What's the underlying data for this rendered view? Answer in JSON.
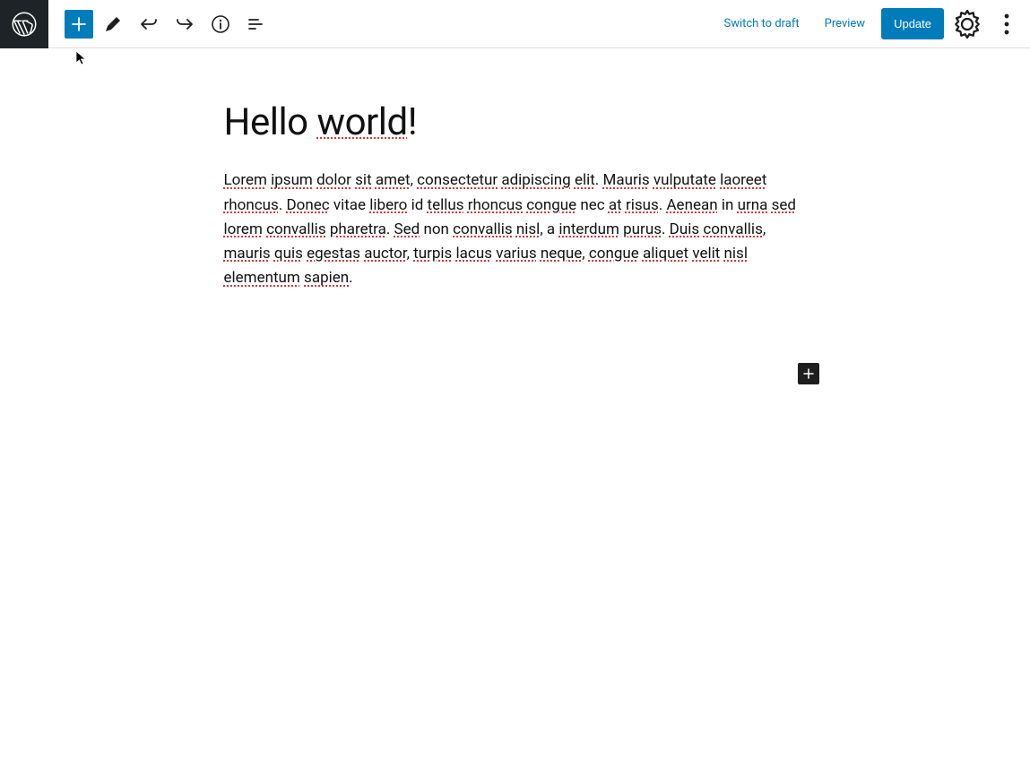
{
  "toolbar": {
    "switch_to_draft": "Switch to draft",
    "preview": "Preview",
    "update": "Update"
  },
  "post": {
    "title_plain": "Hello ",
    "title_misspell": "world",
    "title_tail": "!",
    "body_segments": [
      {
        "t": "Lorem",
        "s": true
      },
      {
        "t": " ",
        "s": false
      },
      {
        "t": "ipsum",
        "s": true
      },
      {
        "t": " ",
        "s": false
      },
      {
        "t": "dolor",
        "s": true
      },
      {
        "t": " ",
        "s": false
      },
      {
        "t": "sit",
        "s": true
      },
      {
        "t": " ",
        "s": false
      },
      {
        "t": "amet",
        "s": true
      },
      {
        "t": ", ",
        "s": false
      },
      {
        "t": "consectetur",
        "s": true
      },
      {
        "t": " ",
        "s": false
      },
      {
        "t": "adipiscing",
        "s": true
      },
      {
        "t": " ",
        "s": false
      },
      {
        "t": "elit",
        "s": true
      },
      {
        "t": ". ",
        "s": false
      },
      {
        "t": "Mauris",
        "s": true
      },
      {
        "t": " ",
        "s": false
      },
      {
        "t": "vulputate",
        "s": true
      },
      {
        "t": " ",
        "s": false
      },
      {
        "t": "laoreet",
        "s": true
      },
      {
        "t": " ",
        "s": false
      },
      {
        "t": "rhoncus",
        "s": true
      },
      {
        "t": ". ",
        "s": false
      },
      {
        "t": "Donec",
        "s": true
      },
      {
        "t": " vitae ",
        "s": false
      },
      {
        "t": "libero",
        "s": true
      },
      {
        "t": " id ",
        "s": false
      },
      {
        "t": "tellus",
        "s": true
      },
      {
        "t": " ",
        "s": false
      },
      {
        "t": "rhoncus",
        "s": true
      },
      {
        "t": " ",
        "s": false
      },
      {
        "t": "congue",
        "s": true
      },
      {
        "t": " nec ",
        "s": false
      },
      {
        "t": "at",
        "s": true
      },
      {
        "t": " ",
        "s": false
      },
      {
        "t": "risus",
        "s": true
      },
      {
        "t": ". ",
        "s": false
      },
      {
        "t": "Aenean",
        "s": true
      },
      {
        "t": " in ",
        "s": false
      },
      {
        "t": "urna",
        "s": true
      },
      {
        "t": " ",
        "s": false
      },
      {
        "t": "sed",
        "s": true
      },
      {
        "t": " ",
        "s": false
      },
      {
        "t": "lorem",
        "s": true
      },
      {
        "t": " ",
        "s": false
      },
      {
        "t": "convallis",
        "s": true
      },
      {
        "t": " ",
        "s": false
      },
      {
        "t": "pharetra",
        "s": true
      },
      {
        "t": ". ",
        "s": false
      },
      {
        "t": "Sed",
        "s": true
      },
      {
        "t": " non ",
        "s": false
      },
      {
        "t": "convallis",
        "s": true
      },
      {
        "t": " ",
        "s": false
      },
      {
        "t": "nisl",
        "s": true
      },
      {
        "t": ", a ",
        "s": false
      },
      {
        "t": "interdum",
        "s": true
      },
      {
        "t": " ",
        "s": false
      },
      {
        "t": "purus",
        "s": true
      },
      {
        "t": ". ",
        "s": false
      },
      {
        "t": "Duis",
        "s": true
      },
      {
        "t": " ",
        "s": false
      },
      {
        "t": "convallis",
        "s": true
      },
      {
        "t": ", ",
        "s": false
      },
      {
        "t": "mauris",
        "s": true
      },
      {
        "t": " ",
        "s": false
      },
      {
        "t": "quis",
        "s": true
      },
      {
        "t": " ",
        "s": false
      },
      {
        "t": "egestas",
        "s": true
      },
      {
        "t": " ",
        "s": false
      },
      {
        "t": "auctor",
        "s": true
      },
      {
        "t": ", ",
        "s": false
      },
      {
        "t": "turpis",
        "s": true
      },
      {
        "t": " ",
        "s": false
      },
      {
        "t": "lacus",
        "s": true
      },
      {
        "t": " ",
        "s": false
      },
      {
        "t": "varius",
        "s": true
      },
      {
        "t": " ",
        "s": false
      },
      {
        "t": "neque",
        "s": true
      },
      {
        "t": ", ",
        "s": false
      },
      {
        "t": "congue",
        "s": true
      },
      {
        "t": " ",
        "s": false
      },
      {
        "t": "aliquet",
        "s": true
      },
      {
        "t": " ",
        "s": false
      },
      {
        "t": "velit",
        "s": true
      },
      {
        "t": " ",
        "s": false
      },
      {
        "t": "nisl",
        "s": true
      },
      {
        "t": " ",
        "s": false
      },
      {
        "t": "elementum",
        "s": true
      },
      {
        "t": " ",
        "s": false
      },
      {
        "t": "sapien",
        "s": true
      },
      {
        "t": ".",
        "s": false
      }
    ]
  }
}
